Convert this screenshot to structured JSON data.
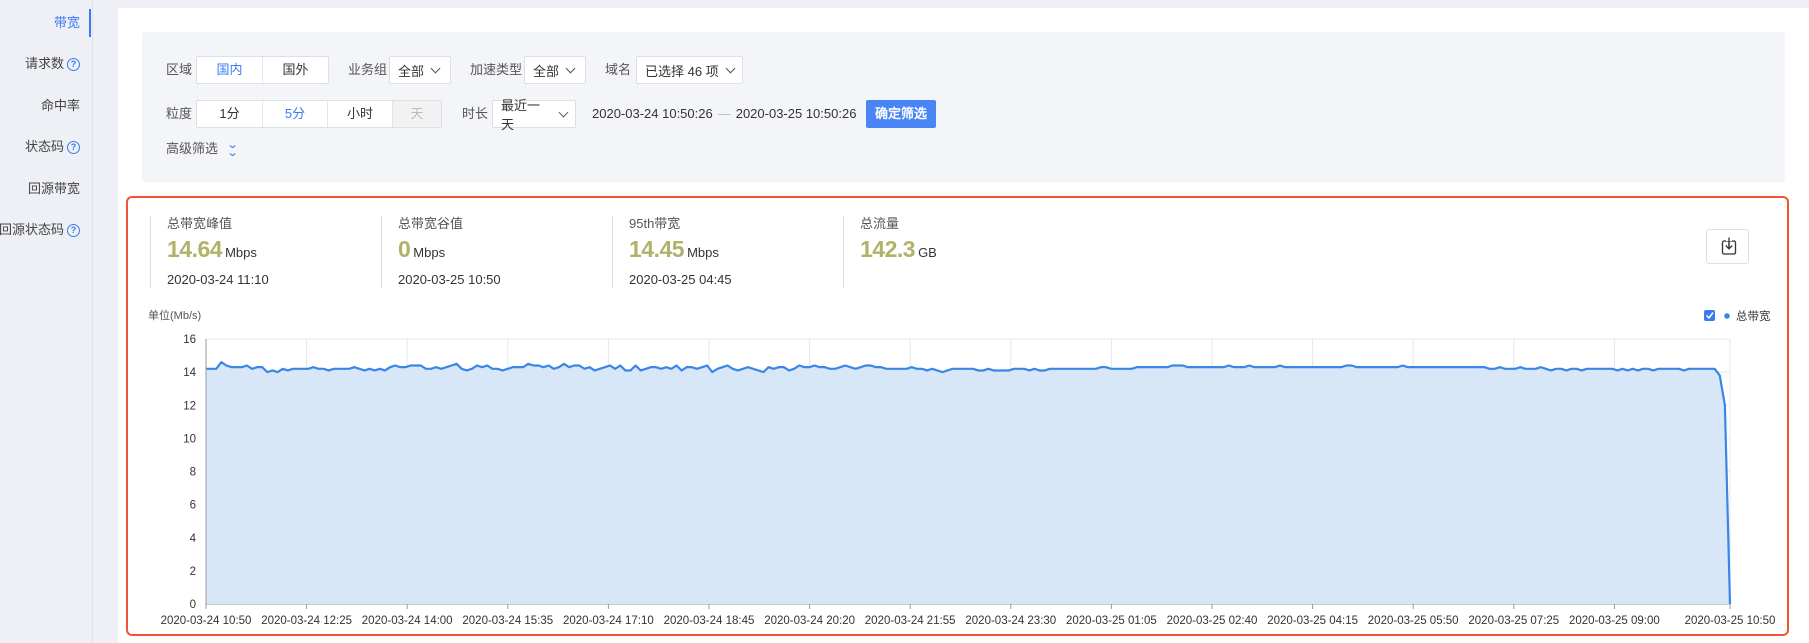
{
  "sidebar": {
    "items": [
      {
        "label": "带宽",
        "active": true,
        "help": false
      },
      {
        "label": "请求数",
        "active": false,
        "help": true
      },
      {
        "label": "命中率",
        "active": false,
        "help": false
      },
      {
        "label": "状态码",
        "active": false,
        "help": true
      },
      {
        "label": "回源带宽",
        "active": false,
        "help": false
      },
      {
        "label": "回源状态码",
        "active": false,
        "help": true
      }
    ]
  },
  "filters": {
    "region_label": "区域",
    "region_options": [
      "国内",
      "国外"
    ],
    "region_selected": "国内",
    "group_label": "业务组",
    "group_value": "全部",
    "accel_label": "加速类型",
    "accel_value": "全部",
    "domain_label": "域名",
    "domain_value": "已选择 46 项",
    "granularity_label": "粒度",
    "granularity_options": [
      "1分",
      "5分",
      "小时",
      "天"
    ],
    "granularity_selected": "5分",
    "duration_label": "时长",
    "duration_value": "最近一天",
    "start_time": "2020-03-24 10:50:26",
    "end_time": "2020-03-25 10:50:26",
    "confirm_button": "确定筛选",
    "advanced_label": "高级筛选"
  },
  "stats": [
    {
      "label": "总带宽峰值",
      "value": "14.64",
      "unit": "Mbps",
      "time": "2020-03-24 11:10"
    },
    {
      "label": "总带宽谷值",
      "value": "0",
      "unit": "Mbps",
      "time": "2020-03-25 10:50"
    },
    {
      "label": "95th带宽",
      "value": "14.45",
      "unit": "Mbps",
      "time": "2020-03-25 04:45"
    },
    {
      "label": "总流量",
      "value": "142.3",
      "unit": "GB",
      "time": ""
    }
  ],
  "colors": {
    "accent": "#3a7bf0",
    "stat_value": "#b0b26a",
    "highlight_border": "#ef5533",
    "line": "#3a86e6",
    "area": "#d6e6f8"
  },
  "chart_data": {
    "type": "area",
    "unit_label": "单位(Mb/s)",
    "legend": [
      {
        "name": "总带宽",
        "checked": true
      }
    ],
    "legend_placement": "top-right",
    "grid": true,
    "ylim": [
      0,
      16
    ],
    "yticks": [
      0,
      2,
      4,
      6,
      8,
      10,
      12,
      14,
      16
    ],
    "xticks": [
      "2020-03-24 10:50",
      "2020-03-24 12:25",
      "2020-03-24 14:00",
      "2020-03-24 15:35",
      "2020-03-24 17:10",
      "2020-03-24 18:45",
      "2020-03-24 20:20",
      "2020-03-24 21:55",
      "2020-03-24 23:30",
      "2020-03-25 01:05",
      "2020-03-25 02:40",
      "2020-03-25 04:15",
      "2020-03-25 05:50",
      "2020-03-25 07:25",
      "2020-03-25 09:00",
      "2020-03-25 10:50"
    ],
    "x_start": "2020-03-24 10:50",
    "x_end": "2020-03-25 10:50",
    "interval_minutes": 5,
    "series": [
      {
        "name": "总带宽",
        "values": [
          14.2,
          14.2,
          14.2,
          14.6,
          14.4,
          14.3,
          14.3,
          14.3,
          14.4,
          14.2,
          14.3,
          14.3,
          14.0,
          14.1,
          14.0,
          14.2,
          14.1,
          14.2,
          14.2,
          14.2,
          14.2,
          14.3,
          14.2,
          14.2,
          14.1,
          14.2,
          14.2,
          14.2,
          14.2,
          14.3,
          14.2,
          14.1,
          14.2,
          14.1,
          14.2,
          14.1,
          14.3,
          14.4,
          14.3,
          14.3,
          14.4,
          14.4,
          14.4,
          14.2,
          14.2,
          14.3,
          14.2,
          14.3,
          14.4,
          14.5,
          14.2,
          14.1,
          14.2,
          14.4,
          14.3,
          14.4,
          14.2,
          14.2,
          14.1,
          14.2,
          14.3,
          14.3,
          14.3,
          14.5,
          14.4,
          14.4,
          14.3,
          14.4,
          14.2,
          14.3,
          14.5,
          14.3,
          14.4,
          14.4,
          14.2,
          14.3,
          14.1,
          14.2,
          14.3,
          14.4,
          14.2,
          14.4,
          14.1,
          14.1,
          14.4,
          14.1,
          14.2,
          14.3,
          14.3,
          14.2,
          14.3,
          14.2,
          14.4,
          14.1,
          14.3,
          14.3,
          14.2,
          14.3,
          14.4,
          14.0,
          14.2,
          14.3,
          14.4,
          14.2,
          14.1,
          14.2,
          14.3,
          14.2,
          14.1,
          14.0,
          14.3,
          14.2,
          14.3,
          14.3,
          14.1,
          14.2,
          14.4,
          14.3,
          14.3,
          14.4,
          14.3,
          14.3,
          14.2,
          14.2,
          14.3,
          14.4,
          14.3,
          14.2,
          14.3,
          14.4,
          14.4,
          14.3,
          14.3,
          14.2,
          14.2,
          14.2,
          14.2,
          14.2,
          14.3,
          14.2,
          14.2,
          14.1,
          14.2,
          14.1,
          14.0,
          14.1,
          14.2,
          14.2,
          14.2,
          14.2,
          14.2,
          14.1,
          14.1,
          14.2,
          14.1,
          14.1,
          14.1,
          14.1,
          14.2,
          14.2,
          14.2,
          14.1,
          14.2,
          14.1,
          14.1,
          14.2,
          14.2,
          14.2,
          14.2,
          14.2,
          14.2,
          14.2,
          14.2,
          14.2,
          14.2,
          14.3,
          14.3,
          14.2,
          14.2,
          14.2,
          14.2,
          14.2,
          14.3,
          14.3,
          14.3,
          14.3,
          14.3,
          14.3,
          14.3,
          14.4,
          14.4,
          14.4,
          14.3,
          14.3,
          14.3,
          14.3,
          14.3,
          14.3,
          14.3,
          14.3,
          14.4,
          14.3,
          14.3,
          14.3,
          14.4,
          14.3,
          14.3,
          14.3,
          14.3,
          14.3,
          14.4,
          14.3,
          14.3,
          14.3,
          14.3,
          14.3,
          14.3,
          14.3,
          14.3,
          14.3,
          14.3,
          14.3,
          14.3,
          14.4,
          14.4,
          14.3,
          14.3,
          14.3,
          14.3,
          14.3,
          14.3,
          14.3,
          14.3,
          14.3,
          14.4,
          14.3,
          14.3,
          14.3,
          14.3,
          14.3,
          14.3,
          14.3,
          14.3,
          14.3,
          14.3,
          14.3,
          14.3,
          14.3,
          14.3,
          14.3,
          14.3,
          14.2,
          14.2,
          14.3,
          14.2,
          14.2,
          14.2,
          14.3,
          14.2,
          14.2,
          14.2,
          14.3,
          14.2,
          14.1,
          14.2,
          14.2,
          14.1,
          14.2,
          14.2,
          14.1,
          14.2,
          14.2,
          14.2,
          14.2,
          14.2,
          14.2,
          14.1,
          14.2,
          14.1,
          14.2,
          14.1,
          14.2,
          14.2,
          14.1,
          14.2,
          14.2,
          14.2,
          14.2,
          14.2,
          14.1,
          14.2,
          14.2,
          14.2,
          14.2,
          14.2,
          14.2,
          13.8,
          12.0,
          0
        ]
      }
    ]
  }
}
